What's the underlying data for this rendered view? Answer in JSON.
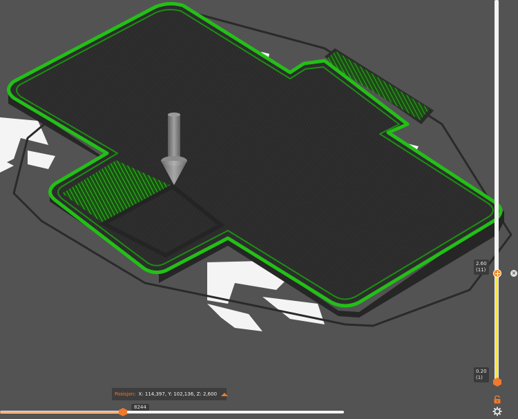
{
  "viewer": {
    "layer_slider": {
      "top_value": "2.60",
      "top_index": "(11)",
      "bottom_value": "0.20",
      "bottom_index": "(1)"
    },
    "move_slider": {
      "value": "8244"
    },
    "position_panel": {
      "title": "Posisjon:",
      "value": "X: 114,397, Y: 102,136, Z: 2,600"
    },
    "icons": {
      "close": "close-icon",
      "lock": "lock-open-icon",
      "settings": "gear-icon",
      "collapse": "triangle-up-icon"
    },
    "colors": {
      "background": "#535353",
      "perimeter": "#22c016",
      "infill": "#2e2e2e",
      "accent": "#f07a2a",
      "layer_range": "#f7e43a"
    }
  }
}
